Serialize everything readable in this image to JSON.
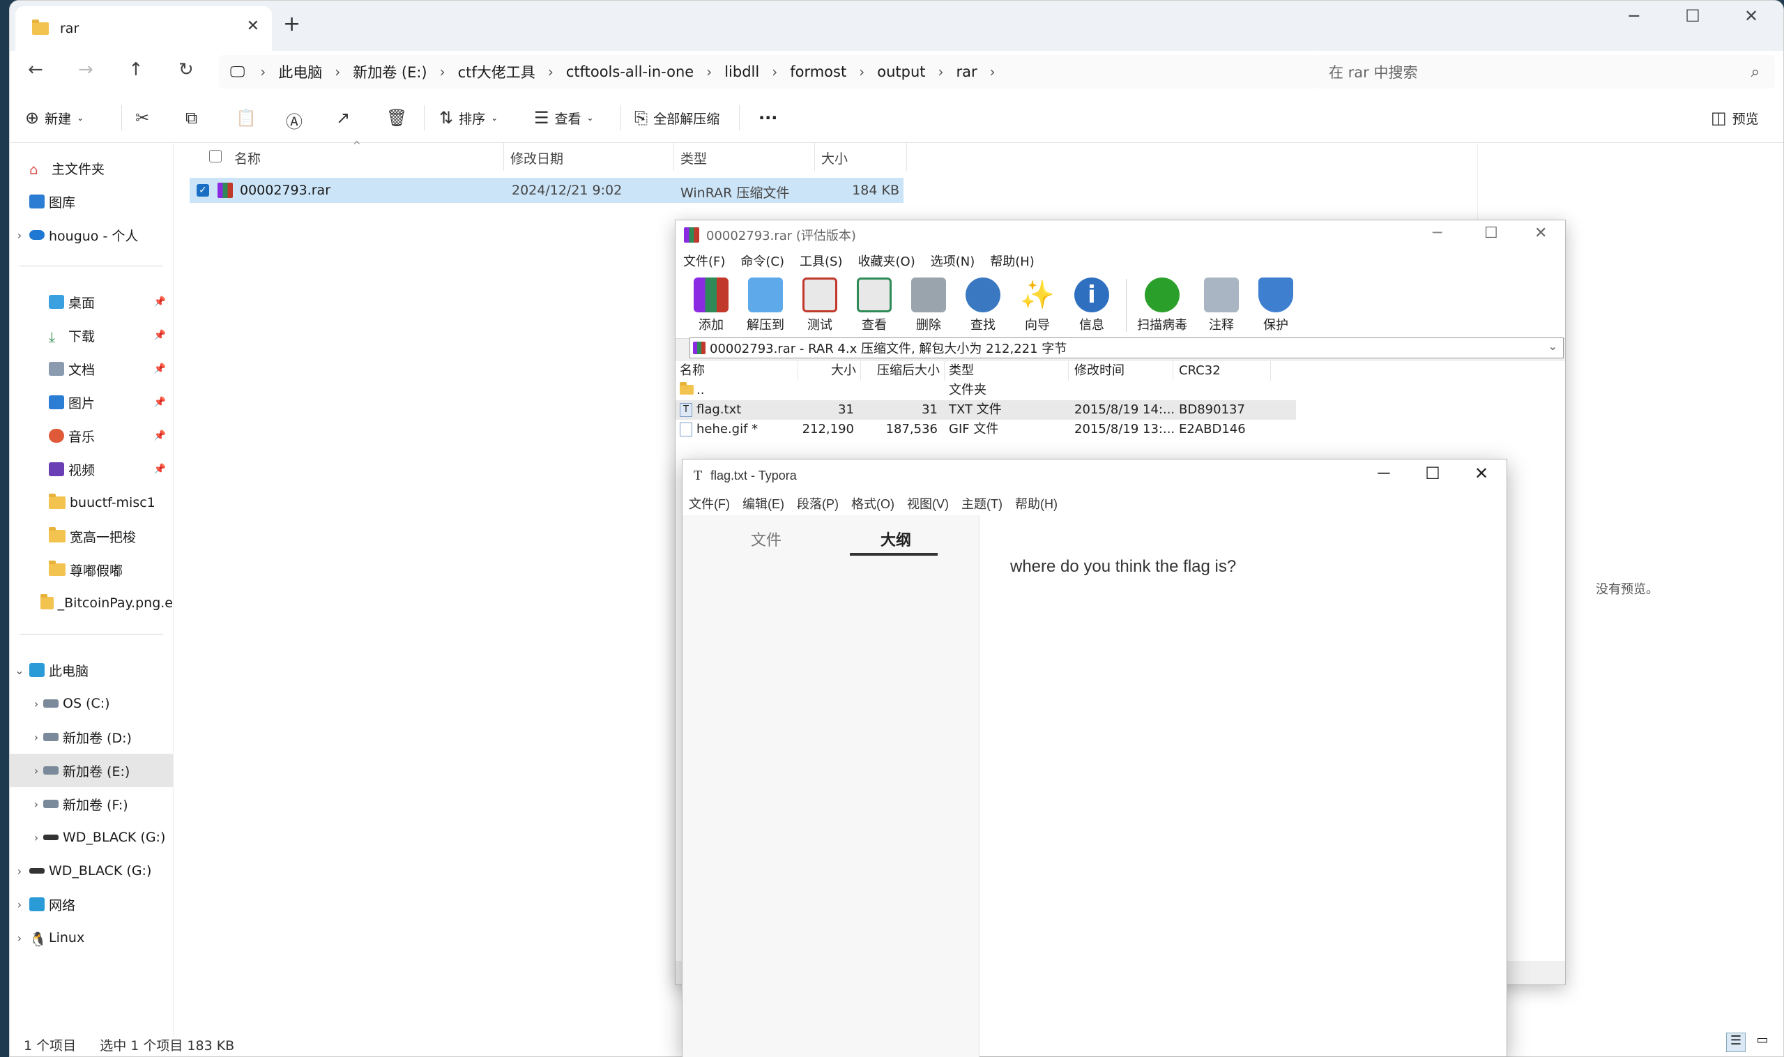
{
  "explorer": {
    "tab_title": "rar",
    "breadcrumb": [
      "此电脑",
      "新加卷 (E:)",
      "ctf大佬工具",
      "ctftools-all-in-one",
      "libdll",
      "formost",
      "output",
      "rar"
    ],
    "search_placeholder": "在 rar 中搜索",
    "toolbar": {
      "new": "新建",
      "sort": "排序",
      "view": "查看",
      "extract_all": "全部解压缩",
      "more": "···",
      "preview": "预览"
    },
    "sidebar": {
      "home": "主文件夹",
      "gallery": "图库",
      "onedrive": "houguo - 个人",
      "desktop": "桌面",
      "downloads": "下载",
      "documents": "文档",
      "pictures": "图片",
      "music": "音乐",
      "videos": "视频",
      "f1": "buuctf-misc1",
      "f2": "宽高一把梭",
      "f3": "尊嘟假嘟",
      "f4": "_BitcoinPay.png.e",
      "thispc": "此电脑",
      "c": "OS (C:)",
      "d": "新加卷 (D:)",
      "e": "新加卷 (E:)",
      "f": "新加卷 (F:)",
      "g1": "WD_BLACK (G:)",
      "g2": "WD_BLACK (G:)",
      "network": "网络",
      "linux": "Linux"
    },
    "columns": {
      "name": "名称",
      "date": "修改日期",
      "type": "类型",
      "size": "大小"
    },
    "file": {
      "name": "00002793.rar",
      "date": "2024/12/21 9:02",
      "type": "WinRAR 压缩文件",
      "size": "184 KB"
    },
    "status": {
      "count": "1 个项目",
      "selected": "选中 1 个项目  183 KB"
    },
    "no_preview": "没有预览。"
  },
  "winrar": {
    "title": "00002793.rar (评估版本)",
    "menu": [
      "文件(F)",
      "命令(C)",
      "工具(S)",
      "收藏夹(O)",
      "选项(N)",
      "帮助(H)"
    ],
    "tools": [
      "添加",
      "解压到",
      "测试",
      "查看",
      "删除",
      "查找",
      "向导",
      "信息",
      "扫描病毒",
      "注释",
      "保护"
    ],
    "path": "00002793.rar - RAR 4.x 压缩文件, 解包大小为 212,221 字节",
    "columns": {
      "name": "名称",
      "size": "大小",
      "packed": "压缩后大小",
      "type": "类型",
      "modified": "修改时间",
      "crc": "CRC32"
    },
    "rows": [
      {
        "name": "..",
        "size": "",
        "packed": "",
        "type": "文件夹",
        "modified": "",
        "crc": ""
      },
      {
        "name": "flag.txt",
        "size": "31",
        "packed": "31",
        "type": "TXT 文件",
        "modified": "2015/8/19 14:...",
        "crc": "BD890137"
      },
      {
        "name": "hehe.gif *",
        "size": "212,190",
        "packed": "187,536",
        "type": "GIF 文件",
        "modified": "2015/8/19 13:...",
        "crc": "E2ABD146"
      }
    ]
  },
  "typora": {
    "title": "flag.txt - Typora",
    "menu": [
      "文件(F)",
      "编辑(E)",
      "段落(P)",
      "格式(O)",
      "视图(V)",
      "主题(T)",
      "帮助(H)"
    ],
    "tab_files": "文件",
    "tab_outline": "大纲",
    "content": "where do you think the flag is?"
  }
}
